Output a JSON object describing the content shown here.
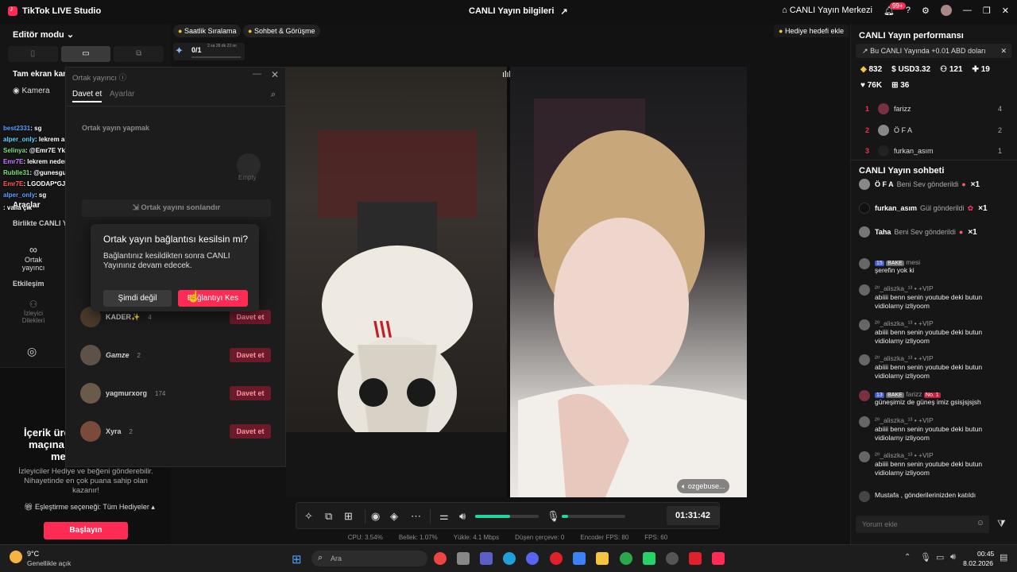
{
  "titlebar": {
    "app": "TikTok LIVE Studio",
    "center": "CANLI Yayın bilgileri",
    "live_center": "CANLI Yayın Merkezi",
    "notif_count": "99+"
  },
  "left": {
    "editor_mode": "Editör modu",
    "fullscreen": "Tam ekran kam",
    "camera": "Kamera",
    "tools": "Araçlar",
    "together": "Birlikte CANLI Y",
    "cohost_label": "Ortak yayıncı",
    "interaction": "Etkileşim",
    "viewer_wishes": "İzleyici\nDilekleri",
    "creator_title_1": "İçerik üret",
    "creator_title_2": "maçına d",
    "creator_title_3": "me",
    "creator_desc": "İzleyiciler Hediye ve beğeni gönderebilir. Nihayetinde en çok puana sahip olan kazanır!",
    "match_option": "Eşleştirme seçeneği: Tüm Hediyeler",
    "start": "Başlayın"
  },
  "top_pills": {
    "hourly": "Saatlik Sıralama",
    "chat": "Sohbet & Görüşme",
    "progress": "0/1",
    "progress_time": "2 sa 28 dk 23 sn",
    "gift_goal": "Hediye hedefi ekle"
  },
  "chat_overlay": [
    {
      "user": "best2331",
      "msg": ": sg"
    },
    {
      "user": "alper_only",
      "msg": ": lekrem abi çık lütfen"
    },
    {
      "user": "Selinya",
      "msg": ": @Emr7E Yks başvuruları başlamış kayıt yaptırdın mı"
    },
    {
      "user": "Emr7E",
      "msg": ": lekrem neden evde kaldığınızı az önceki yayında anladık özge hanım"
    },
    {
      "user": "Rublle31",
      "msg": ": @gunesgul abla sana iltifa edip sonuna abla yenge demeyeni banlio"
    },
    {
      "user": "Emr7E",
      "msg": ": LGODAP*GJKDFI*GJIDF0JGIOPDFJNIDFNJIPOHMFDGI"
    },
    {
      "user": "alper_only",
      "msg": ": sg"
    },
    {
      "user": "",
      "msg": ": valla çık"
    }
  ],
  "cohost": {
    "title": "Ortak yayıncı",
    "tab_invite": "Davet et",
    "tab_settings": "Ayarlar",
    "make_cohost": "Ortak yayın yapmak",
    "empty": "Empty",
    "end_cohost": "Ortak yayını sonlandır",
    "invite_label": "Davet et",
    "rows": [
      {
        "name": "KADER✨",
        "count": "4"
      },
      {
        "name": "Gamze",
        "count": "2"
      },
      {
        "name": "yagmurxorg",
        "count": "174"
      },
      {
        "name": "Xyra",
        "count": "2"
      }
    ]
  },
  "dialog": {
    "title": "Ortak yayın bağlantısı kesilsin mi?",
    "body": "Bağlantınız kesildikten sonra CANLI Yayınınız devam edecek.",
    "cancel": "Şimdi değil",
    "confirm": "Bağlantıyı Kes"
  },
  "video": {
    "guest_name": "ozgebuse..."
  },
  "controls": {
    "timer": "01:31:42",
    "mic_level": 0.1,
    "volume_level": 0.55
  },
  "stats": {
    "cpu": "CPU:  3.54%",
    "mem": "Bellek:  1.07%",
    "upload": "Yükle:  4.1 Mbps",
    "drop": "Düşen çerçeve:  0",
    "encoder": "Encoder FPS:  80",
    "fps": "FPS:  60"
  },
  "right": {
    "perf_title": "CANLI Yayın performansı",
    "perf_note": "Bu CANLI Yayında +0.01 ABD doları",
    "coins": "832",
    "usd": "USD3.32",
    "people": "121",
    "shares": "19",
    "likes": "76K",
    "gifts": "36",
    "ranking": [
      {
        "n": "1",
        "name": "farizz",
        "v": "4"
      },
      {
        "n": "2",
        "name": "Ö F A",
        "v": "2"
      },
      {
        "n": "3",
        "name": "furkan_asım",
        "v": "1"
      }
    ],
    "chat_title": "CANLI Yayın sohbeti",
    "gifts_feed": [
      {
        "name": "Ö F A",
        "action": "Beni Sev gönderildi",
        "x": "×1"
      },
      {
        "name": "furkan_asım",
        "action": "Gül gönderildi",
        "x": "×1"
      },
      {
        "name": "Taha",
        "action": "Beni Sev gönderildi",
        "x": "×1"
      }
    ],
    "comments": [
      {
        "hdr": "mesi",
        "lvl": "15",
        "fan": "BAKE",
        "txt": "şerefin yok ki"
      },
      {
        "hdr": "²⁰_aliszka_¹³ • +VIP",
        "txt": "abiiii benn senin youtube deki butun vidiolarny izliyoom"
      },
      {
        "hdr": "²⁰_aliszka_¹³ • +VIP",
        "txt": "abiiii benn senin youtube deki butun vidiolarny izliyoom"
      },
      {
        "hdr": "²⁰_aliszka_¹³ • +VIP",
        "txt": "abiiii benn senin youtube deki butun vidiolarny izliyoom"
      },
      {
        "hdr": "farizz",
        "lvl": "13",
        "fan": "BAKE",
        "badge": "No. 1",
        "txt": "güneşimiz de güneş imiz gsisjsjsjsh"
      },
      {
        "hdr": "²⁰_aliszka_¹³ • +VIP",
        "txt": "abiiii benn senin youtube deki butun vidiolarny izliyoom"
      },
      {
        "hdr": "²⁰_aliszka_¹³ • +VIP",
        "txt": "abiiii benn senin youtube deki butun vidiolarny izliyoom"
      }
    ],
    "joined": "Mustafa , gönderilerinizden katıldı",
    "comment_placeholder": "Yorum ekle"
  },
  "taskbar": {
    "weather_temp": "9°C",
    "weather_desc": "Genellikle açık",
    "search_placeholder": "Ara",
    "time": "00:45",
    "date": "8.02.2026"
  },
  "colors": {
    "accent": "#fe2c55",
    "volume": "#20d5a0"
  }
}
